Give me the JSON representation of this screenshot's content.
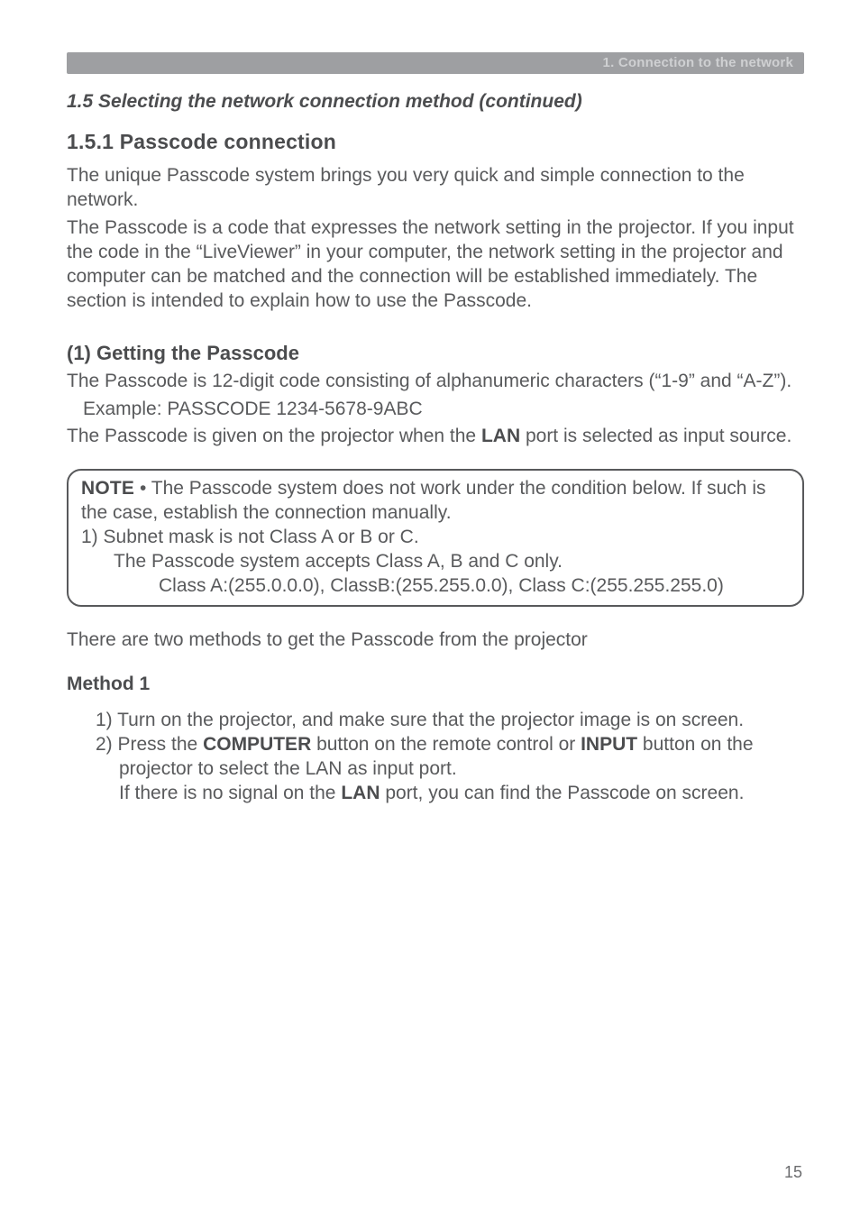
{
  "header": {
    "chapter": "1. Connection to the network"
  },
  "continued": "1.5 Selecting the network connection method (continued)",
  "s151": {
    "title": "1.5.1 Passcode connection",
    "p1": "The unique Passcode system brings you very quick and simple connection to the network.",
    "p2": "The Passcode is a code that expresses the network setting in the projector. If you input the code in the “LiveViewer” in your computer, the network setting in the projector and computer can be matched and the connection will be established immediately. The section is intended to explain how to use the Passcode."
  },
  "getpc": {
    "title": "(1) Getting the Passcode",
    "p1": "The Passcode is 12-digit code consisting of alphanumeric characters (“1-9” and “A-Z”).",
    "ex": "Example: PASSCODE 1234-5678-9ABC",
    "p2a": "The Passcode is given on the projector when the ",
    "p2b": "LAN",
    "p2c": " port is selected as input source."
  },
  "note": {
    "label": "NOTE",
    "l1": " • The Passcode system does not work under the condition below. If such is the case, establish the connection manually.",
    "l2": "1) Subnet mask is not Class A or B or C.",
    "l3": "The Passcode system accepts Class A, B and C only.",
    "l4": "Class A:(255.0.0.0), ClassB:(255.255.0.0), Class C:(255.255.255.0)"
  },
  "methods": {
    "intro": "There are two methods to get the Passcode from the projector",
    "m1label": "Method 1",
    "s1": "1) Turn on the projector, and make sure that the projector image is on screen.",
    "s2a": "2) Press the ",
    "s2b": "COMPUTER",
    "s2c": " button on the remote control or ",
    "s2d": "INPUT",
    "s2e": " button on the projector to select the LAN as input port.",
    "s2f": "If there is no signal on the ",
    "s2g": "LAN",
    "s2h": " port, you can find the Passcode on screen."
  },
  "page": "15"
}
